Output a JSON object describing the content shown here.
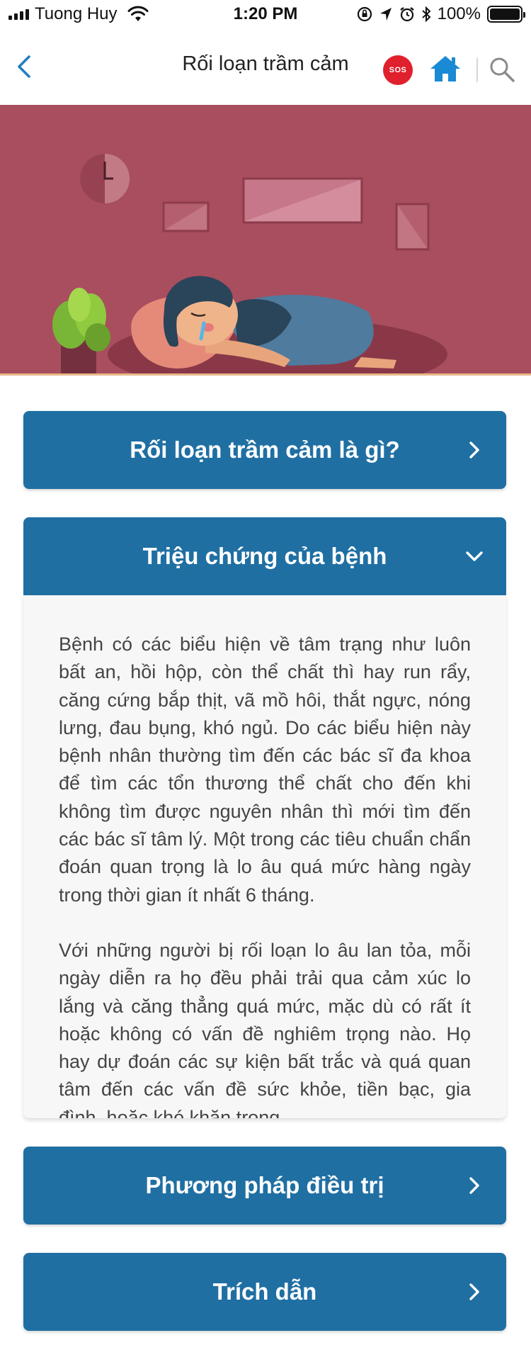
{
  "status_bar": {
    "carrier": "Tuong Huy",
    "time": "1:20 PM",
    "battery": "100%"
  },
  "nav": {
    "title": "Rối loạn trầm cảm",
    "sos_label": "SOS"
  },
  "colors": {
    "accent": "#1f6fa3",
    "hero_bg": "#a84e5e",
    "sos": "#e0202c",
    "home_icon": "#1a8ad4"
  },
  "sections": [
    {
      "label": "Rối loạn trầm cảm là gì?",
      "expanded": false,
      "icon": "chevron-right-icon"
    },
    {
      "label": "Triệu chứng của bệnh",
      "expanded": true,
      "icon": "chevron-down-icon",
      "paragraphs": [
        "Bệnh có các biểu hiện về tâm trạng như luôn bất an, hồi hộp, còn thể chất thì hay run rẩy, căng cứng bắp thịt, vã mồ hôi, thắt ngực, nóng lưng, đau bụng, khó ngủ. Do các biểu hiện này bệnh nhân thường tìm đến các bác sĩ đa khoa để tìm các tổn thương thể chất cho đến khi không tìm được nguyên nhân thì mới tìm đến các bác sĩ tâm lý. Một trong các tiêu chuẩn chẩn đoán quan trọng là lo âu quá mức hàng ngày trong thời gian ít nhất 6 tháng.",
        "Với những người bị rối loạn lo âu lan tỏa, mỗi ngày diễn ra họ đều phải trải qua cảm xúc lo lắng và căng thẳng quá mức, mặc dù có rất ít hoặc không có vấn đề nghiêm trọng nào. Họ hay dự đoán các sự kiện bất trắc và quá quan tâm đến các vấn đề sức khỏe, tiền bạc, gia đình, hoặc khó khăn trong"
      ]
    },
    {
      "label": "Phương pháp điều trị",
      "expanded": false,
      "icon": "chevron-right-icon"
    },
    {
      "label": "Trích dẫn",
      "expanded": false,
      "icon": "chevron-right-icon"
    }
  ]
}
